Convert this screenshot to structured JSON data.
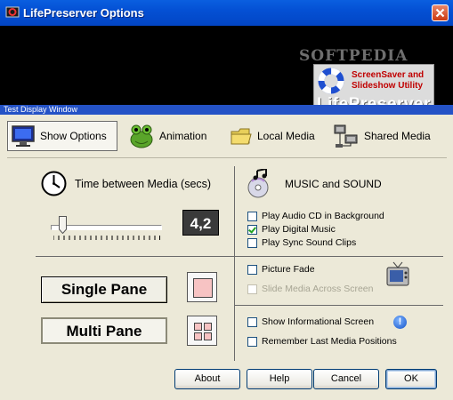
{
  "window": {
    "title": "LifePreserver Options",
    "close_icon": "close-x-icon"
  },
  "preview": {
    "watermark": "SOFTPEDIA",
    "logo_tagline": "ScreenSaver and Slideshow Utility",
    "logo_name": "LifePreserver",
    "caption": "Test Display Window"
  },
  "tabs": [
    {
      "label": "Show Options",
      "icon": "monitor-icon",
      "selected": true
    },
    {
      "label": "Animation",
      "icon": "frog-icon",
      "selected": false
    },
    {
      "label": "Local Media",
      "icon": "folder-icon",
      "selected": false
    },
    {
      "label": "Shared Media",
      "icon": "network-computers-icon",
      "selected": false
    }
  ],
  "timing": {
    "heading": "Time between Media (secs)",
    "value": "4,2",
    "icon": "clock-icon"
  },
  "music": {
    "heading": "MUSIC and SOUND",
    "icon": "cd-music-icon",
    "options": [
      {
        "label": "Play Audio CD in Background",
        "checked": false,
        "enabled": true
      },
      {
        "label": "Play Digital Music",
        "checked": true,
        "enabled": true
      },
      {
        "label": "Play Sync Sound Clips",
        "checked": false,
        "enabled": true
      }
    ]
  },
  "panes": {
    "single_label": "Single Pane",
    "multi_label": "Multi Pane"
  },
  "display_options": [
    {
      "label": "Picture Fade",
      "checked": false,
      "enabled": true
    },
    {
      "label": "Slide Media Across Screen",
      "checked": false,
      "enabled": false
    }
  ],
  "misc_options": [
    {
      "label": "Show Informational Screen",
      "checked": false,
      "enabled": true
    },
    {
      "label": "Remember Last Media Positions",
      "checked": false,
      "enabled": true
    }
  ],
  "info_glyph": "!",
  "buttons": {
    "about": "About",
    "help": "Help",
    "cancel": "Cancel",
    "ok": "OK"
  },
  "colors": {
    "titlebar": "#0450d4",
    "caption_bar": "#2452c6",
    "logo_text": "#c00000",
    "check": "#21a121"
  }
}
